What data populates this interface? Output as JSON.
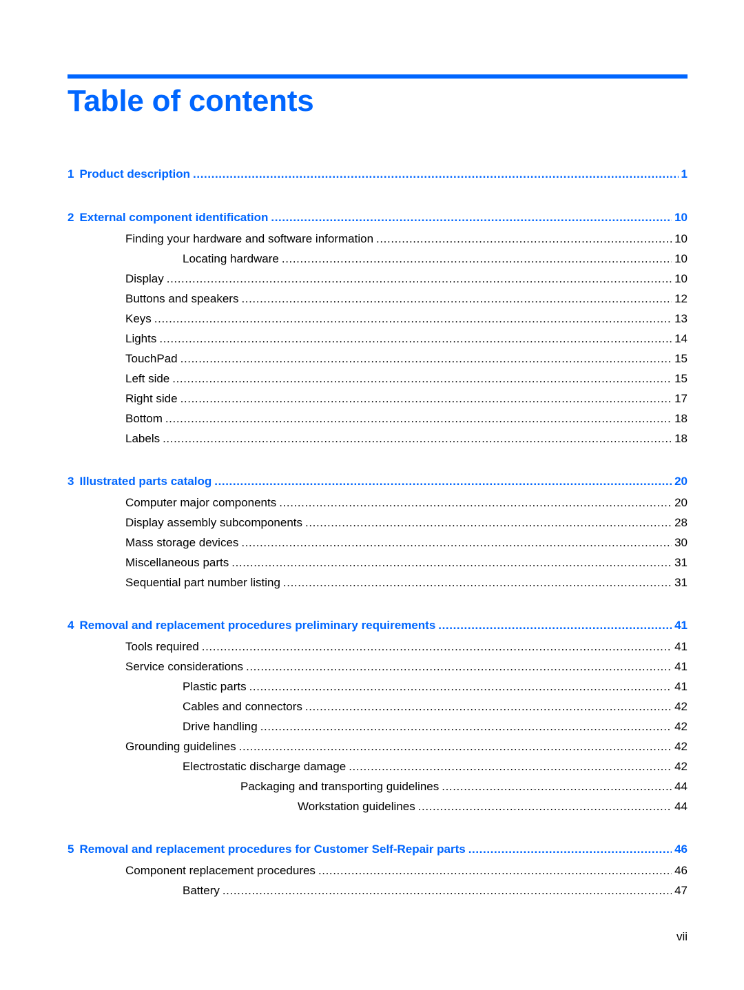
{
  "document": {
    "title": "Table of contents",
    "page_folio": "vii",
    "accent_color": "#0066ff"
  },
  "toc": [
    {
      "type": "chapter",
      "num": "1",
      "label": "Product description",
      "page": "1"
    },
    {
      "type": "chapter",
      "num": "2",
      "label": "External component identification",
      "page": "10"
    },
    {
      "type": "section",
      "level": 1,
      "label": "Finding your hardware and software information",
      "page": "10"
    },
    {
      "type": "section",
      "level": 2,
      "label": "Locating hardware",
      "page": "10"
    },
    {
      "type": "section",
      "level": 1,
      "label": "Display",
      "page": "10"
    },
    {
      "type": "section",
      "level": 1,
      "label": "Buttons and speakers",
      "page": "12"
    },
    {
      "type": "section",
      "level": 1,
      "label": "Keys",
      "page": "13"
    },
    {
      "type": "section",
      "level": 1,
      "label": "Lights",
      "page": "14"
    },
    {
      "type": "section",
      "level": 1,
      "label": "TouchPad",
      "page": "15"
    },
    {
      "type": "section",
      "level": 1,
      "label": "Left side",
      "page": "15"
    },
    {
      "type": "section",
      "level": 1,
      "label": "Right side",
      "page": "17"
    },
    {
      "type": "section",
      "level": 1,
      "label": "Bottom",
      "page": "18"
    },
    {
      "type": "section",
      "level": 1,
      "label": "Labels",
      "page": "18"
    },
    {
      "type": "chapter",
      "num": "3",
      "label": "Illustrated parts catalog",
      "page": "20"
    },
    {
      "type": "section",
      "level": 1,
      "label": "Computer major components",
      "page": "20"
    },
    {
      "type": "section",
      "level": 1,
      "label": "Display assembly subcomponents",
      "page": "28"
    },
    {
      "type": "section",
      "level": 1,
      "label": "Mass storage devices",
      "page": "30"
    },
    {
      "type": "section",
      "level": 1,
      "label": "Miscellaneous parts",
      "page": "31"
    },
    {
      "type": "section",
      "level": 1,
      "label": "Sequential part number listing",
      "page": "31"
    },
    {
      "type": "chapter",
      "num": "4",
      "label": "Removal and replacement procedures preliminary requirements",
      "page": "41"
    },
    {
      "type": "section",
      "level": 1,
      "label": "Tools required",
      "page": "41"
    },
    {
      "type": "section",
      "level": 1,
      "label": "Service considerations",
      "page": "41"
    },
    {
      "type": "section",
      "level": 2,
      "label": "Plastic parts",
      "page": "41"
    },
    {
      "type": "section",
      "level": 2,
      "label": "Cables and connectors",
      "page": "42"
    },
    {
      "type": "section",
      "level": 2,
      "label": "Drive handling",
      "page": "42"
    },
    {
      "type": "section",
      "level": 1,
      "label": "Grounding guidelines",
      "page": "42"
    },
    {
      "type": "section",
      "level": 2,
      "label": "Electrostatic discharge damage",
      "page": "42"
    },
    {
      "type": "section",
      "level": 3,
      "label": "Packaging and transporting guidelines",
      "page": "44"
    },
    {
      "type": "section",
      "level": 4,
      "label": "Workstation guidelines",
      "page": "44"
    },
    {
      "type": "chapter",
      "num": "5",
      "label": "Removal and replacement procedures for Customer Self-Repair parts",
      "page": "46"
    },
    {
      "type": "section",
      "level": 1,
      "label": "Component replacement procedures",
      "page": "46"
    },
    {
      "type": "section",
      "level": 2,
      "label": "Battery",
      "page": "47"
    }
  ]
}
